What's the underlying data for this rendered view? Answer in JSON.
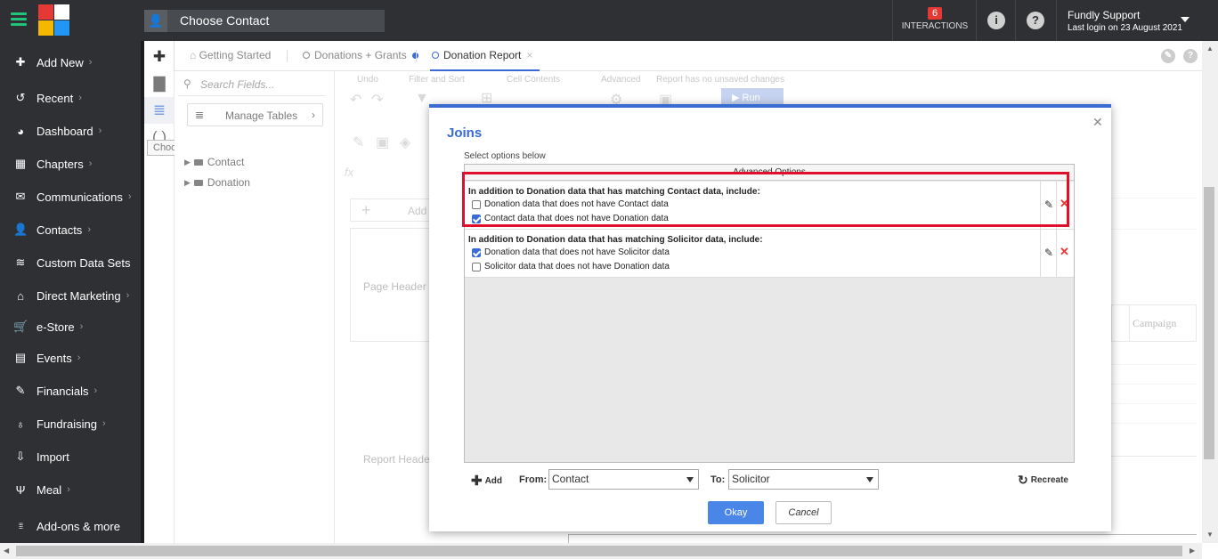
{
  "header": {
    "search_label": "Choose Contact",
    "interactions_count": "6",
    "interactions_label": "INTERACTIONS",
    "user_name": "Fundly Support",
    "last_login": "Last login on 23 August 2021"
  },
  "sidebar": {
    "items": [
      {
        "label": "Add New",
        "icon": "plus-circle-icon",
        "glyph": "✚"
      },
      {
        "label": "Recent",
        "icon": "history-icon",
        "glyph": "↺"
      },
      {
        "label": "Dashboard",
        "icon": "dashboard-icon",
        "glyph": "◕"
      },
      {
        "label": "Chapters",
        "icon": "grid-icon",
        "glyph": "▦"
      },
      {
        "label": "Communications",
        "icon": "envelope-icon",
        "glyph": "✉"
      },
      {
        "label": "Contacts",
        "icon": "user-icon",
        "glyph": "👤"
      },
      {
        "label": "Custom Data Sets",
        "icon": "layers-icon",
        "glyph": "≋"
      },
      {
        "label": "Direct Marketing",
        "icon": "bank-icon",
        "glyph": "⌂"
      },
      {
        "label": "e-Store",
        "icon": "cart-icon",
        "glyph": "🛒"
      },
      {
        "label": "Events",
        "icon": "calendar-icon",
        "glyph": "▤"
      },
      {
        "label": "Financials",
        "icon": "money-icon",
        "glyph": "✎"
      },
      {
        "label": "Fundraising",
        "icon": "money-bag-icon",
        "glyph": "♁"
      },
      {
        "label": "Import",
        "icon": "import-icon",
        "glyph": "⇩"
      },
      {
        "label": "Meal",
        "icon": "cutlery-icon",
        "glyph": "Ψ"
      },
      {
        "label": "Add-ons & more",
        "icon": "apps-icon",
        "glyph": "⁞⁞⁞"
      }
    ]
  },
  "tooltip": "Choose Data",
  "fields": {
    "search_placeholder": "Search Fields...",
    "manage_tables": "Manage Tables",
    "tree": [
      "Contact",
      "Donation"
    ]
  },
  "tabs": [
    {
      "label": "Getting Started"
    },
    {
      "label": "Donations + Grants"
    },
    {
      "label": "Donation Report"
    }
  ],
  "toolbar": {
    "undo": "Undo",
    "filter_sort": "Filter and Sort",
    "cell_contents": "Cell Contents",
    "advanced": "Advanced",
    "unsaved": "Report has no unsaved changes",
    "run": "Run"
  },
  "background": {
    "add": "Add",
    "page_header": "Page Header",
    "report_header": "Report Header",
    "campaign": "Campaign"
  },
  "modal": {
    "title": "Joins",
    "subtitle": "Select options below",
    "grid_header": "Advanced Options",
    "joins": [
      {
        "title": "In addition to Donation data that has matching Contact data, include:",
        "options": [
          {
            "label": "Donation data that does not have Contact data",
            "checked": false
          },
          {
            "label": "Contact data that does not have Donation data",
            "checked": true
          }
        ]
      },
      {
        "title": "In addition to Donation data that has matching Solicitor data, include:",
        "options": [
          {
            "label": "Donation data that does not have Solicitor data",
            "checked": true
          },
          {
            "label": "Solicitor data that does not have Donation data",
            "checked": false
          }
        ]
      }
    ],
    "add_label": "Add",
    "from_label": "From:",
    "from_value": "Contact",
    "to_label": "To:",
    "to_value": "Solicitor",
    "recreate_label": "Recreate",
    "okay_label": "Okay",
    "cancel_label": "Cancel"
  },
  "colors": {
    "accent": "#3a6bd4",
    "sidebar_bg": "#2e3033",
    "highlight": "#e0102c",
    "danger": "#e53935"
  }
}
